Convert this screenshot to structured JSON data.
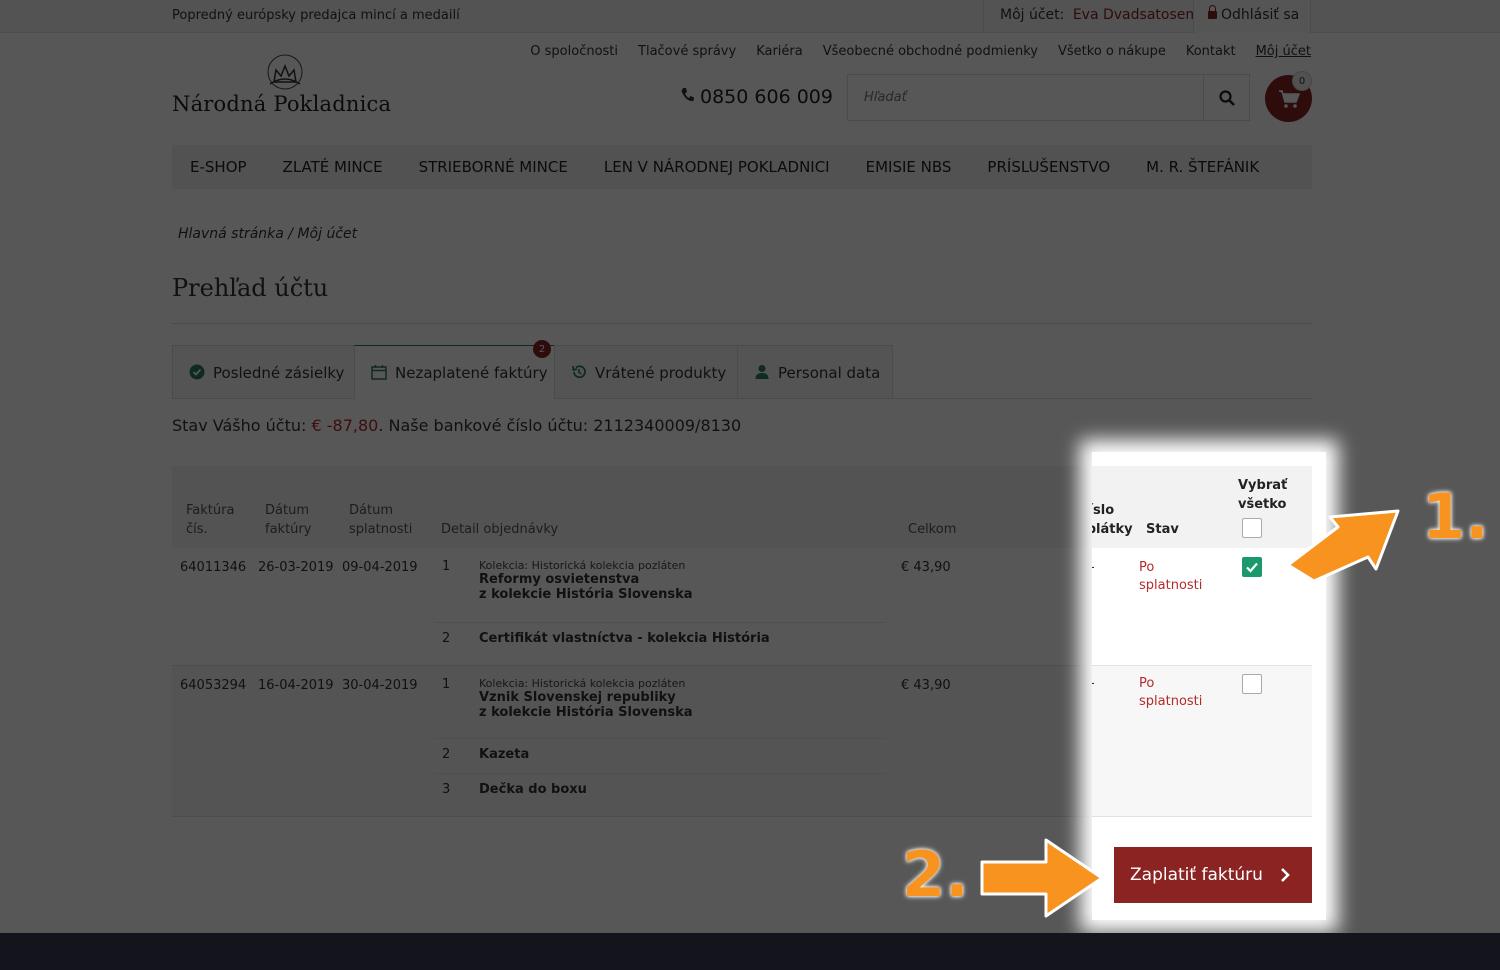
{
  "topbar": {
    "tagline": "Popredný európsky predajca mincí a medailí",
    "account_label": "Môj účet:",
    "user_name": "Eva Dvadsatosem",
    "logout": "Odhlásiť sa"
  },
  "logo": {
    "name": "Národná Pokladnica"
  },
  "toplinks": [
    "O spoločnosti",
    "Tlačové správy",
    "Kariéra",
    "Všeobecné obchodné podmienky",
    "Všetko o nákupe",
    "Kontakt",
    "Môj účet"
  ],
  "phone": "0850 606 009",
  "search": {
    "placeholder": "Hľadať"
  },
  "cart": {
    "count": "0"
  },
  "nav": [
    "E-SHOP",
    "ZLATÉ MINCE",
    "STRIEBORNÉ MINCE",
    "LEN V NÁRODNEJ POKLADNICI",
    "EMISIE NBS",
    "PRÍSLUŠENSTVO",
    "M. R. ŠTEFÁNIK"
  ],
  "breadcrumb": "Hlavná stránka  /  Môj účet",
  "page_title": "Prehľad účtu",
  "tabs": [
    {
      "label": "Posledné zásielky"
    },
    {
      "label": "Nezaplatené faktúry",
      "badge": "2"
    },
    {
      "label": "Vrátené produkty"
    },
    {
      "label": "Personal data"
    }
  ],
  "balance": {
    "prefix": "Stav Vášho účtu: ",
    "amount": "€ -87,80",
    "suffix": ". Naše bankové číslo účtu: 2112340009/8130"
  },
  "table": {
    "headers": {
      "invoice_1": "Faktúra",
      "invoice_2": "čís.",
      "date_1": "Dátum",
      "date_2": "faktúry",
      "due_1": "Dátum",
      "due_2": "splatnosti",
      "detail": "Detail objednávky",
      "total": "Celkom",
      "inst_1": "Číslo",
      "inst_2": "splátky",
      "status": "Stav",
      "select_1": "Vybrať",
      "select_2": "všetko"
    },
    "rows": [
      {
        "invoice": "64011346",
        "date": "26-03-2019",
        "due": "09-04-2019",
        "items": [
          {
            "n": "1",
            "collection": "Kolekcia: Historická kolekcia pozláten",
            "line1": "Reformy osvietenstva",
            "line2": "z kolekcie História Slovenska"
          },
          {
            "n": "2",
            "line1": "Certifikát vlastníctva - kolekcia História"
          }
        ],
        "total": "€ 43,90",
        "installment": "-",
        "status": "Po splatnosti",
        "checked": true
      },
      {
        "invoice": "64053294",
        "date": "16-04-2019",
        "due": "30-04-2019",
        "items": [
          {
            "n": "1",
            "collection": "Kolekcia: Historická kolekcia pozláten",
            "line1": "Vznik Slovenskej republiky",
            "line2": "z kolekcie História Slovenska"
          },
          {
            "n": "2",
            "line1": "Kazeta"
          },
          {
            "n": "3",
            "line1": "Dečka do boxu"
          }
        ],
        "total": "€ 43,90",
        "installment": "-",
        "status": "Po splatnosti",
        "checked": false
      }
    ]
  },
  "pay_button": "Zaplatiť faktúru",
  "annotations": {
    "step1": "1.",
    "step2": "2."
  },
  "colors": {
    "brand": "#8b2323",
    "accent_green": "#1a9a6c",
    "arrow": "#f7931e"
  }
}
